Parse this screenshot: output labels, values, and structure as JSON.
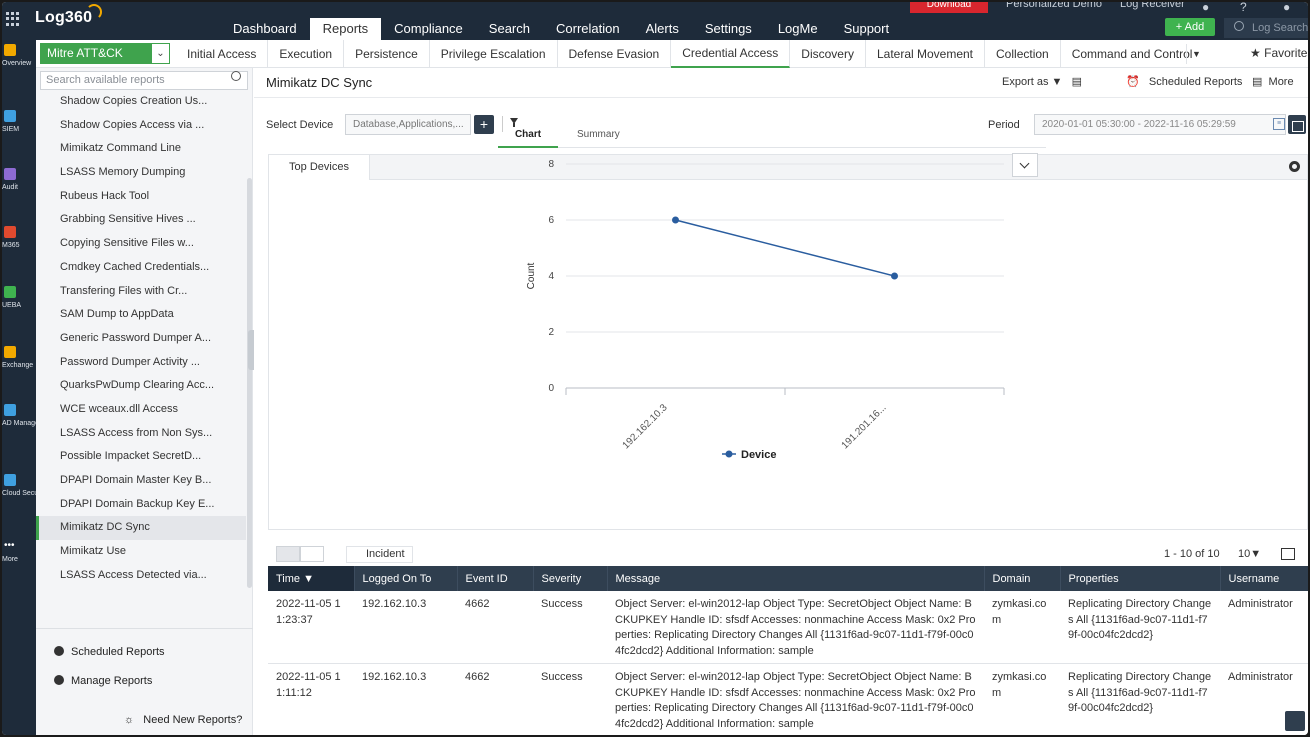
{
  "app": {
    "logo": "Log360",
    "download": "Download",
    "personalized_demo": "Personalized Demo",
    "log_receiver": "Log Receiver",
    "add_label": "+ Add",
    "search_placeholder": "Log Search"
  },
  "main_nav": [
    "Dashboard",
    "Reports",
    "Compliance",
    "Search",
    "Correlation",
    "Alerts",
    "Settings",
    "LogMe",
    "Support"
  ],
  "main_nav_active": "Reports",
  "rail": [
    {
      "label": "Overview",
      "icon": "grid-icon",
      "color": "#f2a900"
    },
    {
      "label": "SIEM",
      "icon": "shield-icon",
      "color": "#3fa0e0"
    },
    {
      "label": "Audit",
      "icon": "magnifier-icon",
      "color": "#8e6bd3"
    },
    {
      "label": "M365",
      "icon": "office-icon",
      "color": "#e04a2f"
    },
    {
      "label": "UEBA",
      "icon": "eye-icon",
      "color": "#3fb34f"
    },
    {
      "label": "Exchange",
      "icon": "mail-icon",
      "color": "#f2a900"
    },
    {
      "label": "AD Management",
      "icon": "ad-icon",
      "color": "#3fa0e0"
    },
    {
      "label": "Cloud Security",
      "icon": "cloud-icon",
      "color": "#3fa0e0"
    },
    {
      "label": "More",
      "icon": "dots-icon",
      "color": "#ffffff"
    }
  ],
  "category_select": "Mitre ATT&CK",
  "categories": [
    "Initial Access",
    "Execution",
    "Persistence",
    "Privilege Escalation",
    "Defense Evasion",
    "Credential Access",
    "Discovery",
    "Lateral Movement",
    "Collection",
    "Command and Control"
  ],
  "category_active": "Credential Access",
  "favorites": "Favorites",
  "sidebar": {
    "search_placeholder": "Search available reports",
    "reports": [
      "Shadow Copies Creation Us...",
      "Shadow Copies Access via ...",
      "Mimikatz Command Line",
      "LSASS Memory Dumping",
      "Rubeus Hack Tool",
      "Grabbing Sensitive Hives ...",
      "Copying Sensitive Files w...",
      "Cmdkey Cached Credentials...",
      "Transfering Files with Cr...",
      "SAM Dump to AppData",
      "Generic Password Dumper A...",
      "Password Dumper Activity ...",
      "QuarksPwDump Clearing Acc...",
      "WCE wceaux.dll Access",
      "LSASS Access from Non Sys...",
      "Possible Impacket SecretD...",
      "DPAPI Domain Master Key B...",
      "DPAPI Domain Backup Key E...",
      "Mimikatz DC Sync",
      "Mimikatz Use",
      "LSASS Access Detected via..."
    ],
    "active_report": "Mimikatz DC Sync",
    "scheduled_reports": "Scheduled Reports",
    "manage_reports": "Manage Reports",
    "need_new_reports": "Need New Reports?"
  },
  "content": {
    "title": "Mimikatz DC Sync",
    "export_as": "Export as",
    "scheduled_reports": "Scheduled Reports",
    "more": "More",
    "select_device_label": "Select Device",
    "select_device_value": "Database,Applications,...",
    "period_label": "Period",
    "period_value": "2020-01-01 05:30:00 - 2022-11-16 05:29:59",
    "panel_tab": "Top Devices",
    "chart_tab": "Chart",
    "summary_tab": "Summary"
  },
  "chart_data": {
    "type": "line",
    "x": [
      "192.162.10.3",
      "191.201.16..."
    ],
    "series": [
      {
        "name": "Device",
        "values": [
          6,
          4
        ]
      }
    ],
    "ylabel": "Count",
    "xlabel": "",
    "ylim": [
      0,
      8
    ],
    "yticks": [
      0,
      2,
      4,
      6,
      8
    ],
    "grid": true,
    "legend": "bottom",
    "color": "#2a5d9f"
  },
  "table": {
    "incident_label": "Incident",
    "pager": "1 - 10 of 10",
    "per_page": "10",
    "columns": [
      "Time",
      "Logged On To",
      "Event ID",
      "Severity",
      "Message",
      "Domain",
      "Properties",
      "Username"
    ],
    "rows": [
      {
        "time": "2022-11-05 11:23:37",
        "logged_on_to": "192.162.10.3",
        "event_id": "4662",
        "severity": "Success",
        "message": "Object Server: el-win2012-lap Object Type: SecretObject Object Name: BCKUPKEY Handle ID: sfsdf Accesses: nonmachine Access Mask: 0x2 Properties: Replicating Directory Changes All {1131f6ad-9c07-11d1-f79f-00c04fc2dcd2} Additional Information: sample",
        "domain": "zymkasi.com",
        "properties": "Replicating Directory Changes All {1131f6ad-9c07-11d1-f79f-00c04fc2dcd2}",
        "username": "Administrator"
      },
      {
        "time": "2022-11-05 11:11:12",
        "logged_on_to": "192.162.10.3",
        "event_id": "4662",
        "severity": "Success",
        "message": "Object Server: el-win2012-lap Object Type: SecretObject Object Name: BCKUPKEY Handle ID: sfsdf Accesses: nonmachine Access Mask: 0x2 Properties: Replicating Directory Changes All {1131f6ad-9c07-11d1-f79f-00c04fc2dcd2} Additional Information: sample",
        "domain": "zymkasi.com",
        "properties": "Replicating Directory Changes All {1131f6ad-9c07-11d1-f79f-00c04fc2dcd2}",
        "username": "Administrator"
      }
    ]
  }
}
